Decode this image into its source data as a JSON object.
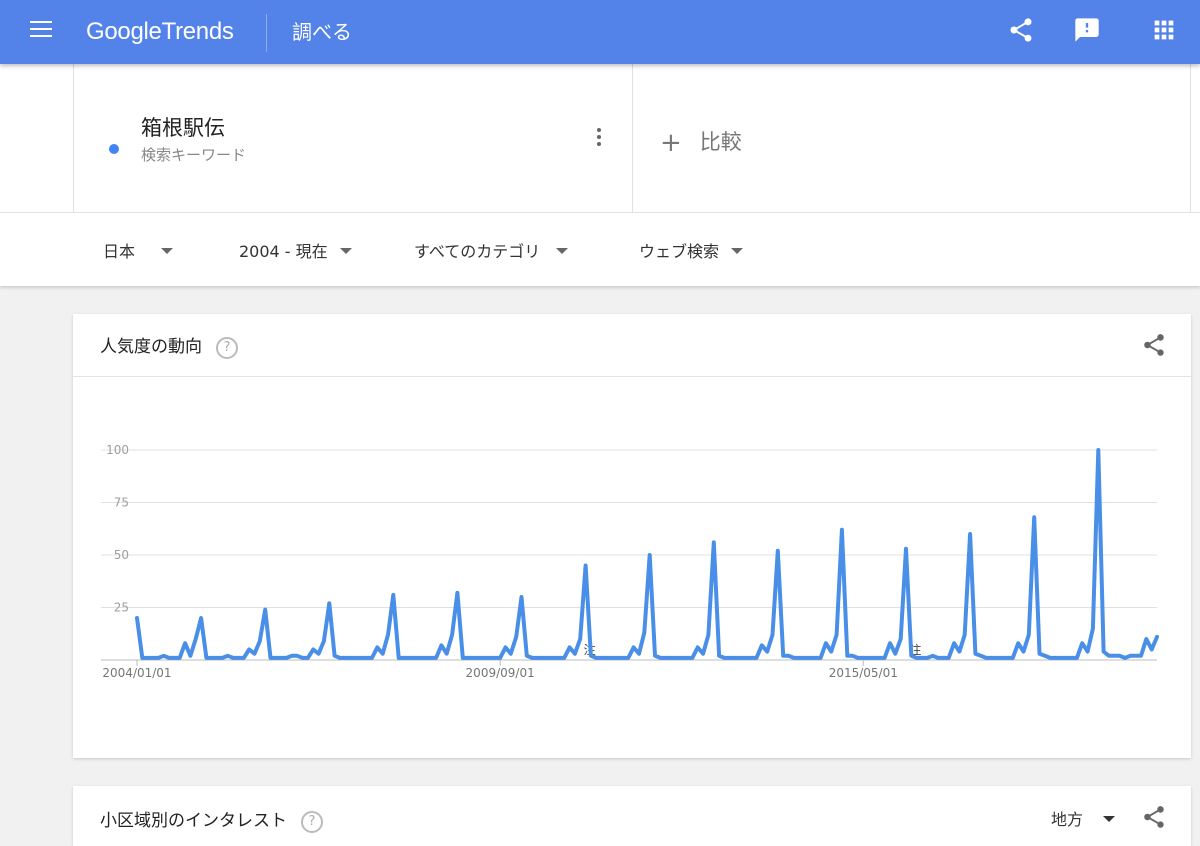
{
  "header": {
    "logo_part1": "Google",
    "logo_part2": "Trends",
    "explore": "調べる",
    "icons": [
      "menu-icon",
      "share-icon",
      "feedback-icon",
      "apps-icon"
    ],
    "color": "#5383e8"
  },
  "keyword": {
    "term": "箱根駅伝",
    "type": "検索キーワード",
    "color": "#4285f4",
    "add_label": "比較"
  },
  "filters": [
    {
      "label": "日本"
    },
    {
      "label": "2004 - 現在"
    },
    {
      "label": "すべてのカテゴリ"
    },
    {
      "label": "ウェブ検索"
    }
  ],
  "trend_card": {
    "title": "人気度の動向",
    "help": "?"
  },
  "region_card": {
    "title": "小区域別のインタレスト",
    "help": "?",
    "resolution": "地方"
  },
  "chart_data": {
    "type": "line",
    "ylim": [
      0,
      100
    ],
    "y_ticks": [
      25,
      50,
      75,
      100
    ],
    "x_ticks": [
      "2004/01/01",
      "2009/09/01",
      "2015/05/01"
    ],
    "x_tick_index": [
      0,
      68,
      136
    ],
    "grid": true,
    "line_color": "#4a8fe7",
    "annotations": [
      {
        "label": "注",
        "index": 84
      },
      {
        "label": "注",
        "index": 145
      }
    ],
    "series": [
      {
        "values": [
          20,
          1,
          1,
          1,
          1,
          2,
          1,
          1,
          1,
          8,
          2,
          10,
          20,
          1,
          1,
          1,
          1,
          2,
          1,
          1,
          1,
          5,
          3,
          9,
          24,
          1,
          1,
          1,
          1,
          2,
          2,
          1,
          1,
          5,
          3,
          9,
          27,
          2,
          1,
          1,
          1,
          1,
          1,
          1,
          1,
          6,
          3,
          12,
          31,
          1,
          1,
          1,
          1,
          1,
          1,
          1,
          1,
          7,
          3,
          12,
          32,
          1,
          1,
          1,
          1,
          1,
          1,
          1,
          1,
          6,
          3,
          11,
          30,
          2,
          1,
          1,
          1,
          1,
          1,
          1,
          1,
          6,
          3,
          10,
          45,
          2,
          1,
          1,
          1,
          1,
          1,
          1,
          1,
          6,
          3,
          13,
          50,
          2,
          1,
          1,
          1,
          1,
          1,
          1,
          1,
          6,
          3,
          12,
          56,
          2,
          1,
          1,
          1,
          1,
          1,
          1,
          1,
          7,
          4,
          12,
          52,
          2,
          2,
          1,
          1,
          1,
          1,
          1,
          1,
          8,
          4,
          12,
          62,
          2,
          2,
          1,
          1,
          1,
          1,
          1,
          1,
          8,
          3,
          10,
          53,
          2,
          1,
          1,
          1,
          2,
          1,
          1,
          1,
          8,
          4,
          12,
          60,
          3,
          2,
          1,
          1,
          1,
          1,
          1,
          1,
          8,
          4,
          12,
          68,
          3,
          2,
          1,
          1,
          1,
          1,
          1,
          1,
          8,
          4,
          15,
          100,
          4,
          2,
          2,
          2,
          1,
          2,
          2,
          2,
          10,
          5,
          11
        ]
      }
    ]
  }
}
